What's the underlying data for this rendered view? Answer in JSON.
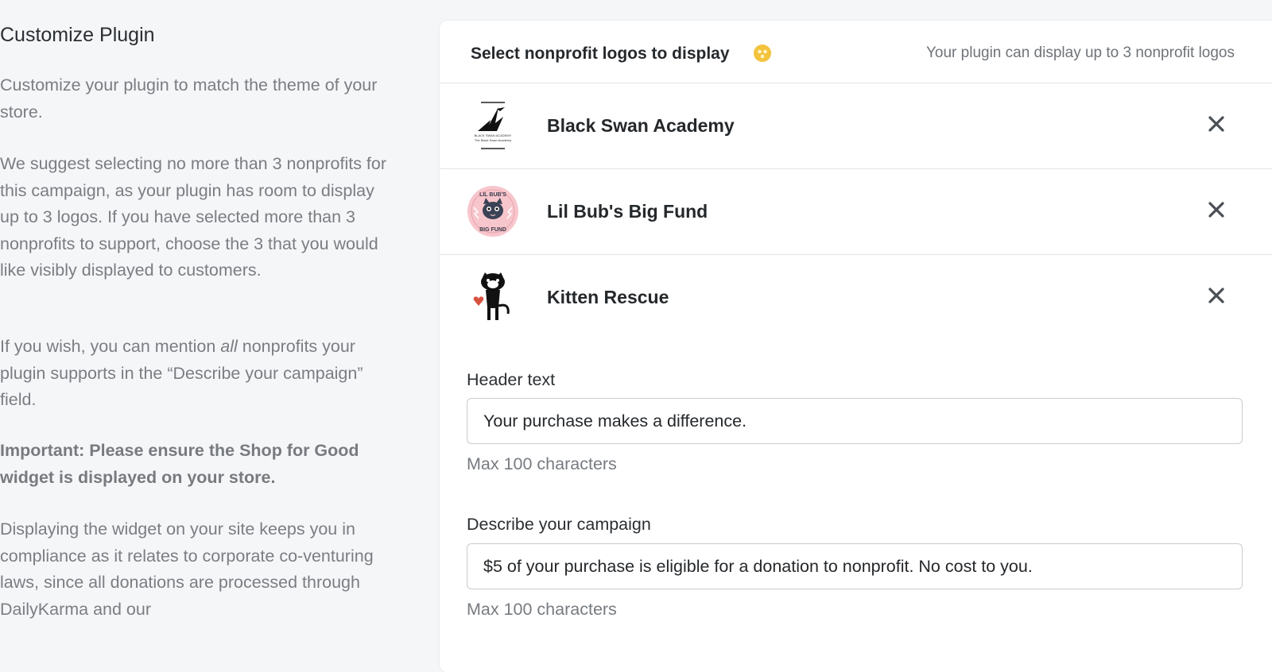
{
  "left": {
    "title": "Customize Plugin",
    "para1": "Customize your plugin to match the theme of your store.",
    "para2": "We suggest selecting no more than 3 nonprofits for this campaign, as your plugin has room to display up to 3 logos. If you have selected more than 3 nonprofits to support, choose the 3 that you would like visibly displayed to customers.",
    "para3_before": "If you wish, you can mention ",
    "para3_em": "all",
    "para3_after": " nonprofits your plugin supports in the “Describe your campaign” field.",
    "important": "Important: Please ensure the Shop for Good widget is displayed on your store.",
    "para4": "Displaying the widget on your site keeps you in compliance as it relates to corporate co-venturing laws, since all donations are processed through DailyKarma and our"
  },
  "card": {
    "title": "Select nonprofit logos to display",
    "info_icon": "info-icon",
    "note": "Your plugin can display up to 3 nonprofit logos",
    "nonprofits": [
      {
        "name": "Black Swan Academy",
        "logo_text": "The Black Swan Academy"
      },
      {
        "name": "Lil Bub's Big Fund",
        "logo_top": "LIL BUB'S",
        "logo_bottom": "BIG FUND"
      },
      {
        "name": "Kitten Rescue"
      }
    ],
    "header_field": {
      "label": "Header text",
      "value": "Your purchase makes a difference.",
      "help": "Max 100 characters"
    },
    "campaign_field": {
      "label": "Describe your campaign",
      "value": "$5 of your purchase is eligible for a donation to nonprofit. No cost to you.",
      "help": "Max 100 characters"
    }
  },
  "colors": {
    "background": "#f5f6f8",
    "card": "#ffffff",
    "info_icon": "#f3c33c",
    "text_muted": "#7a7d82"
  }
}
